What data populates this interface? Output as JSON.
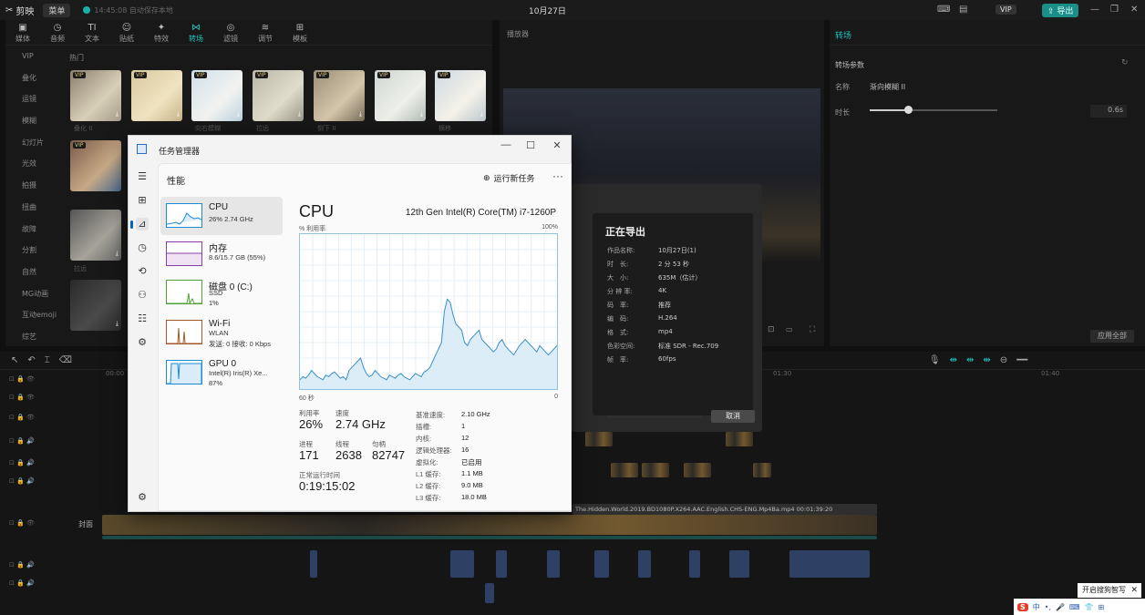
{
  "editor": {
    "logo": "剪映",
    "menu": "菜单",
    "autosave": "14:45:08 自动保存本地",
    "project": "10月27日",
    "vip": "VIP",
    "export": "导出"
  },
  "media": {
    "tabs": [
      {
        "glyph": "▣",
        "label": "媒体"
      },
      {
        "glyph": "◷",
        "label": "音频"
      },
      {
        "glyph": "TI",
        "label": "文本"
      },
      {
        "glyph": "☺",
        "label": "贴纸"
      },
      {
        "glyph": "✦",
        "label": "特效"
      },
      {
        "glyph": "⋈",
        "label": "转场"
      },
      {
        "glyph": "◎",
        "label": "滤镜"
      },
      {
        "glyph": "≋",
        "label": "调节"
      },
      {
        "glyph": "⊞",
        "label": "模板"
      }
    ],
    "categories": [
      "VIP",
      "叠化",
      "运镜",
      "模糊",
      "幻灯片",
      "光效",
      "拍摄",
      "扭曲",
      "故障",
      "分割",
      "自然",
      "MG动画",
      "互动emoji",
      "综艺"
    ],
    "section": "热门",
    "thumb_labels": [
      "叠化 II",
      "",
      "向右模糊",
      "",
      "拉远",
      "",
      "倒下 II",
      "",
      "横移",
      "",
      "",
      "拉远"
    ]
  },
  "player": {
    "title": "播放器"
  },
  "props": {
    "head": "转场",
    "section": "转场参数",
    "name_label": "名称",
    "name_value": "渐向模糊 II",
    "duration_label": "时长",
    "duration_value": "0.6s",
    "apply_all": "应用全部"
  },
  "export_dialog": {
    "title": "正在导出",
    "rows": [
      {
        "k": "作品名称:",
        "v": "10月27日(1)"
      },
      {
        "k": "时　长:",
        "v": "2 分 53 秒"
      },
      {
        "k": "大　小:",
        "v": "635M（估计）"
      },
      {
        "k": "分 辨 率:",
        "v": "4K"
      },
      {
        "k": "码　率:",
        "v": "推荐"
      },
      {
        "k": "编　码:",
        "v": "H.264"
      },
      {
        "k": "格　式:",
        "v": "mp4"
      },
      {
        "k": "色彩空间:",
        "v": "标准 SDR - Rec.709"
      },
      {
        "k": "帧　率:",
        "v": "60fps"
      }
    ],
    "cancel": "取消"
  },
  "timeline": {
    "cover_label": "封面",
    "clip_title": "The.Hidden.World.2019.BD1080P.X264.AAC.English.CHS-ENG.Mp4Ba.mp4",
    "clip_duration": "00:01:39:20",
    "ruler": [
      "00:00",
      "",
      "",
      "",
      "",
      "",
      "",
      "",
      "01:30",
      "",
      "",
      "",
      "01:40"
    ]
  },
  "taskmgr": {
    "window_title": "任务管理器",
    "header": "性能",
    "run_new_task": "运行新任务",
    "resources": [
      {
        "name": "CPU",
        "sub": [
          "26% 2.74 GHz"
        ],
        "color": "#1c8bd3"
      },
      {
        "name": "内存",
        "sub": [
          "8.6/15.7 GB (55%)"
        ],
        "color": "#8a3fa8"
      },
      {
        "name": "磁盘 0 (C:)",
        "sub": [
          "SSD",
          "1%"
        ],
        "color": "#4da033"
      },
      {
        "name": "Wi-Fi",
        "sub": [
          "WLAN",
          "发送: 0 接收: 0 Kbps"
        ],
        "color": "#a3582a"
      },
      {
        "name": "GPU 0",
        "sub": [
          "Intel(R) Iris(R) Xe...",
          "87%"
        ],
        "color": "#1c8bd3"
      }
    ],
    "detail": {
      "title": "CPU",
      "model": "12th Gen Intel(R) Core(TM) i7-1260P",
      "y_label": "% 利用率",
      "y_max": "100%",
      "x_left": "60 秒",
      "x_right": "0",
      "stats": [
        {
          "k": "利用率",
          "v": "26%"
        },
        {
          "k": "速度",
          "v": "2.74 GHz"
        },
        {
          "k": "进程",
          "v": "171"
        },
        {
          "k": "线程",
          "v": "2638"
        },
        {
          "k": "句柄",
          "v": "82747"
        },
        {
          "k": "正常运行时间",
          "v": "0:19:15:02"
        }
      ],
      "specs": [
        {
          "k": "基准速度:",
          "v": "2.10 GHz"
        },
        {
          "k": "插槽:",
          "v": "1"
        },
        {
          "k": "内核:",
          "v": "12"
        },
        {
          "k": "逻辑处理器:",
          "v": "16"
        },
        {
          "k": "虚拟化:",
          "v": "已启用"
        },
        {
          "k": "L1 缓存:",
          "v": "1.1 MB"
        },
        {
          "k": "L2 缓存:",
          "v": "9.0 MB"
        },
        {
          "k": "L3 缓存:",
          "v": "18.0 MB"
        }
      ],
      "cpu_history": [
        6,
        8,
        7,
        9,
        12,
        10,
        8,
        7,
        6,
        9,
        8,
        10,
        11,
        9,
        7,
        8,
        6,
        12,
        14,
        16,
        18,
        20,
        14,
        10,
        8,
        9,
        12,
        10,
        8,
        7,
        6,
        9,
        8,
        7,
        9,
        10,
        8,
        7,
        6,
        8,
        10,
        9,
        8,
        11,
        12,
        14,
        18,
        22,
        26,
        30,
        50,
        58,
        56,
        48,
        42,
        40,
        38,
        30,
        28,
        32,
        34,
        36,
        38,
        32,
        30,
        28,
        26,
        24,
        26,
        30,
        32,
        28,
        26,
        24,
        22,
        25,
        28,
        30,
        32,
        30,
        28,
        26,
        24,
        28,
        26,
        24,
        22,
        24,
        26,
        28
      ]
    }
  },
  "ime_tooltip": "开启搜狗智写",
  "tray": {
    "s": "S",
    "zh": "中"
  }
}
